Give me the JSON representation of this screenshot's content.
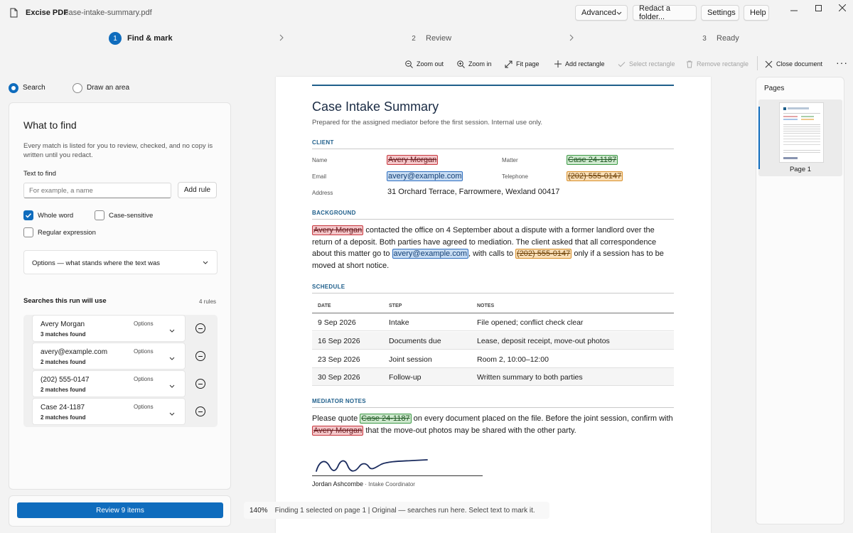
{
  "app": {
    "name": "Excise PDF",
    "filename": "case-intake-summary.pdf"
  },
  "header_buttons": {
    "advanced": "Advanced",
    "redact_folder": "Redact a folder...",
    "settings": "Settings",
    "help": "Help"
  },
  "steps": [
    {
      "num": "1",
      "label": "Find & mark",
      "active": true
    },
    {
      "num": "2",
      "label": "Review",
      "active": false
    },
    {
      "num": "3",
      "label": "Ready",
      "active": false
    }
  ],
  "toolbar": {
    "zoom_out": "Zoom out",
    "zoom_in": "Zoom in",
    "fit_page": "Fit page",
    "add_rectangle": "Add rectangle",
    "select_rectangle": "Select rectangle",
    "remove_rectangle": "Remove rectangle",
    "close_document": "Close document"
  },
  "mode": {
    "search": "Search",
    "draw": "Draw an area",
    "selected": "search"
  },
  "find": {
    "title": "What to find",
    "description": "Every match is listed for you to review, checked, and no copy is written until you redact.",
    "text_label": "Text to find",
    "placeholder": "For example, a name",
    "add_rule": "Add rule",
    "whole_word": "Whole word",
    "case_sensitive": "Case-sensitive",
    "regex": "Regular expression",
    "options_dropdown": "Options — what stands where the text was"
  },
  "rules": {
    "title": "Searches this run will use",
    "count": "4 rules",
    "items": [
      {
        "name": "Avery Morgan",
        "matches": "3 matches found",
        "options": "Options"
      },
      {
        "name": "avery@example.com",
        "matches": "2 matches found",
        "options": "Options"
      },
      {
        "name": "(202) 555-0147",
        "matches": "2 matches found",
        "options": "Options"
      },
      {
        "name": "Case 24-1187",
        "matches": "2 matches found",
        "options": "Options"
      }
    ]
  },
  "review_button": "Review 9 items",
  "status": {
    "zoom": "140%",
    "text": "Finding 1 selected on page 1  |  Original — searches run here. Select text to mark it."
  },
  "pages": {
    "title": "Pages",
    "page1": "Page 1"
  },
  "document": {
    "title": "Case Intake Summary",
    "subtitle": "Prepared for the assigned mediator before the first session. Internal use only.",
    "client_heading": "CLIENT",
    "labels": {
      "name": "Name",
      "email": "Email",
      "address": "Address",
      "matter": "Matter",
      "telephone": "Telephone"
    },
    "values": {
      "name": "Avery Morgan",
      "email": "avery@example.com",
      "address": "31 Orchard Terrace, Farrowmere, Wexland 00417",
      "matter": "Case 24-1187",
      "telephone": "(202) 555-0147"
    },
    "background_heading": "BACKGROUND",
    "background": {
      "name": "Avery Morgan",
      "t1": " contacted the office on 4 September about a dispute with a former landlord over the return of a deposit. Both parties have agreed to mediation. The client asked that all correspondence about this matter go to ",
      "email": "avery@example.com",
      "t2": ", with calls to ",
      "phone": "(202) 555-0147",
      "t3": " only if a session has to be moved at short notice."
    },
    "schedule_heading": "SCHEDULE",
    "schedule_cols": [
      "DATE",
      "STEP",
      "NOTES"
    ],
    "schedule": [
      {
        "date": "9 Sep 2026",
        "step": "Intake",
        "notes": "File opened; conflict check clear"
      },
      {
        "date": "16 Sep 2026",
        "step": "Documents due",
        "notes": "Lease, deposit receipt, move-out photos"
      },
      {
        "date": "23 Sep 2026",
        "step": "Joint session",
        "notes": "Room 2, 10:00–12:00"
      },
      {
        "date": "30 Sep 2026",
        "step": "Follow-up",
        "notes": "Written summary to both parties"
      }
    ],
    "notes_heading": "MEDIATOR NOTES",
    "notes": {
      "t1": "Please quote ",
      "case": "Case 24-1187",
      "t2": " on every document placed on the file. Before the joint session, confirm with ",
      "name": "Avery Morgan",
      "t3": " that the move-out photos may be shared with the other party."
    },
    "signer": "Jordan Ashcombe",
    "signer_role": " · Intake Coordinator"
  },
  "colors": {
    "accent": "#0f6cbd",
    "name_hl": "#c8383f",
    "email_hl": "#2f6fc0",
    "phone_hl": "#d9902a",
    "case_hl": "#3d9a46"
  }
}
